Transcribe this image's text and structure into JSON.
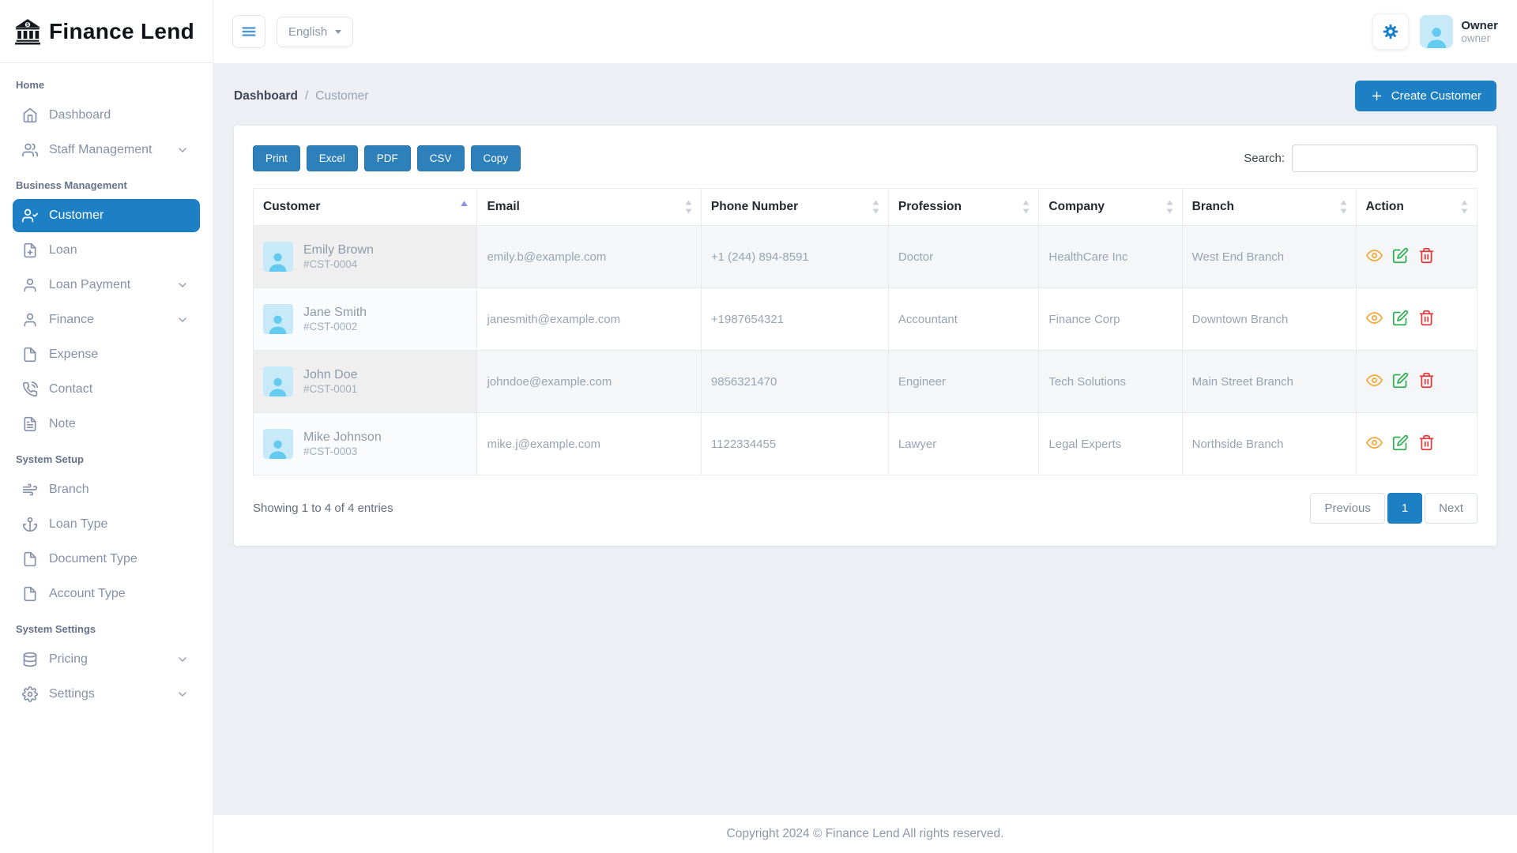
{
  "brand": {
    "name": "Finance Lend"
  },
  "topbar": {
    "language": "English",
    "user": {
      "name": "Owner",
      "role": "owner"
    }
  },
  "breadcrumb": {
    "items": [
      "Dashboard",
      "Customer"
    ],
    "separator": "/"
  },
  "page": {
    "create_button": "Create Customer"
  },
  "sidebar": {
    "sections": [
      {
        "heading": "Home",
        "items": [
          {
            "label": "Dashboard",
            "icon": "home-icon"
          },
          {
            "label": "Staff Management",
            "icon": "users-icon",
            "expandable": true
          }
        ]
      },
      {
        "heading": "Business Management",
        "items": [
          {
            "label": "Customer",
            "icon": "user-check-icon",
            "active": true
          },
          {
            "label": "Loan",
            "icon": "file-plus-icon"
          },
          {
            "label": "Loan Payment",
            "icon": "user-icon",
            "expandable": true
          },
          {
            "label": "Finance",
            "icon": "user-icon",
            "expandable": true
          },
          {
            "label": "Expense",
            "icon": "file-icon"
          },
          {
            "label": "Contact",
            "icon": "phone-icon"
          },
          {
            "label": "Note",
            "icon": "file-text-icon"
          }
        ]
      },
      {
        "heading": "System Setup",
        "items": [
          {
            "label": "Branch",
            "icon": "wind-icon"
          },
          {
            "label": "Loan Type",
            "icon": "anchor-icon"
          },
          {
            "label": "Document Type",
            "icon": "file-icon"
          },
          {
            "label": "Account Type",
            "icon": "file-icon"
          }
        ]
      },
      {
        "heading": "System Settings",
        "items": [
          {
            "label": "Pricing",
            "icon": "database-icon",
            "expandable": true
          },
          {
            "label": "Settings",
            "icon": "settings-icon",
            "expandable": true
          }
        ]
      }
    ]
  },
  "toolbar": {
    "buttons": [
      "Print",
      "Excel",
      "PDF",
      "CSV",
      "Copy"
    ],
    "search_label": "Search:",
    "search_value": ""
  },
  "table": {
    "columns": [
      {
        "label": "Customer",
        "sort": "asc"
      },
      {
        "label": "Email"
      },
      {
        "label": "Phone Number"
      },
      {
        "label": "Profession"
      },
      {
        "label": "Company"
      },
      {
        "label": "Branch"
      },
      {
        "label": "Action"
      }
    ],
    "rows": [
      {
        "name": "Emily Brown",
        "code": "#CST-0004",
        "email": "emily.b@example.com",
        "phone": "+1 (244) 894-8591",
        "profession": "Doctor",
        "company": "HealthCare Inc",
        "branch": "West End Branch"
      },
      {
        "name": "Jane Smith",
        "code": "#CST-0002",
        "email": "janesmith@example.com",
        "phone": "+1987654321",
        "profession": "Accountant",
        "company": "Finance Corp",
        "branch": "Downtown Branch"
      },
      {
        "name": "John Doe",
        "code": "#CST-0001",
        "email": "johndoe@example.com",
        "phone": "9856321470",
        "profession": "Engineer",
        "company": "Tech Solutions",
        "branch": "Main Street Branch"
      },
      {
        "name": "Mike Johnson",
        "code": "#CST-0003",
        "email": "mike.j@example.com",
        "phone": "1122334455",
        "profession": "Lawyer",
        "company": "Legal Experts",
        "branch": "Northside Branch"
      }
    ],
    "actions": [
      "eye-icon",
      "edit-icon",
      "trash-icon"
    ]
  },
  "table_footer": {
    "showing": "Showing 1 to 4 of 4 entries",
    "previous": "Previous",
    "page": "1",
    "next": "Next"
  },
  "footer": {
    "copyright": "Copyright 2024 © Finance Lend All rights reserved."
  },
  "colors": {
    "primary_blue": "#1d80c4",
    "button_blue": "#2d80b9",
    "view_orange": "#f2a93b",
    "edit_green": "#2fae53",
    "delete_red": "#e23a3a",
    "avatar_bg": "#c7e9f8",
    "avatar_fg": "#63cbf0"
  }
}
